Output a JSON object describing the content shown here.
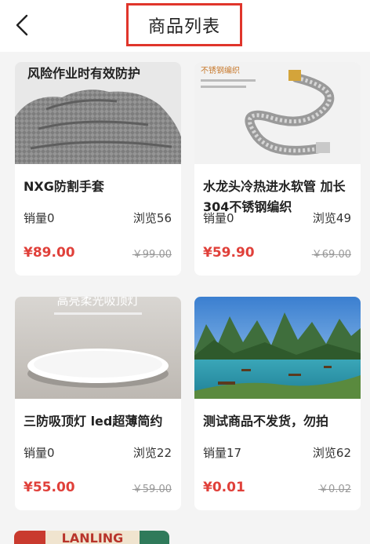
{
  "header": {
    "title": "商品列表"
  },
  "products": [
    {
      "name": "NXG防割手套",
      "sales_label": "销量",
      "sales": "0",
      "views_label": "浏览",
      "views": "56",
      "price": "¥89.00",
      "original_price": "￥99.00",
      "image_text": "风险作业时有效防护"
    },
    {
      "name": "水龙头冷热进水软管 加长304不锈钢编织",
      "sales_label": "销量",
      "sales": "0",
      "views_label": "浏览",
      "views": "49",
      "price": "¥59.90",
      "original_price": "￥69.00",
      "image_text": "不锈钢编织"
    },
    {
      "name": "三防吸顶灯 led超薄简约",
      "sales_label": "销量",
      "sales": "0",
      "views_label": "浏览",
      "views": "22",
      "price": "¥55.00",
      "original_price": "￥59.00",
      "image_text": "高亮柔光吸顶灯"
    },
    {
      "name": "测试商品不发货，勿拍",
      "sales_label": "销量",
      "sales": "17",
      "views_label": "浏览",
      "views": "62",
      "price": "¥0.01",
      "original_price": "￥0.02",
      "image_text": ""
    }
  ],
  "partial_card": {
    "image_text": "LANLING"
  },
  "colors": {
    "accent": "#e0403a",
    "title_border": "#e0352b",
    "background": "#f4f4f4"
  }
}
